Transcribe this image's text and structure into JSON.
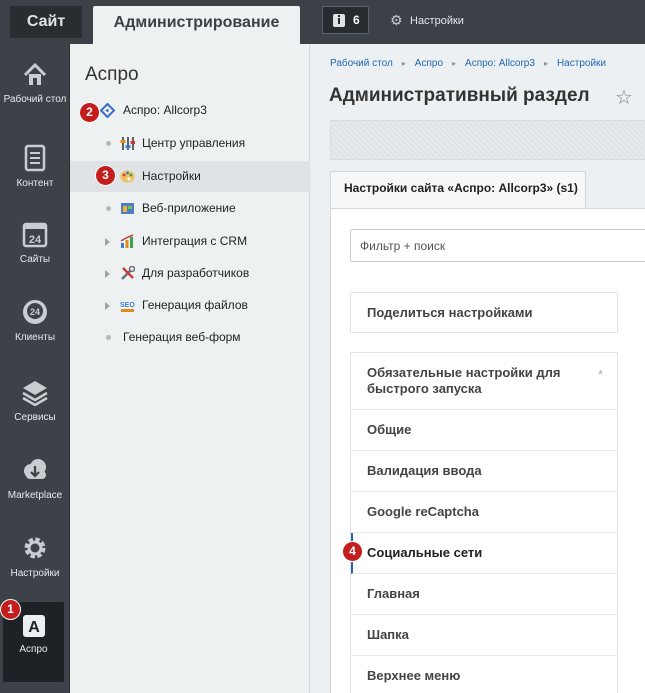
{
  "topbar": {
    "site_tab": "Сайт",
    "admin_tab": "Администрирование",
    "notifications_count": "6",
    "settings_label": "Настройки"
  },
  "rail": {
    "items": [
      {
        "label": "Рабочий стол",
        "icon": "home-icon"
      },
      {
        "label": "Контент",
        "icon": "document-icon"
      },
      {
        "label": "Сайты",
        "icon": "calendar-icon"
      },
      {
        "label": "Клиенты",
        "icon": "clients-icon"
      },
      {
        "label": "Сервисы",
        "icon": "layers-icon"
      },
      {
        "label": "Marketplace",
        "icon": "cloud-download-icon"
      },
      {
        "label": "Настройки",
        "icon": "gear-icon"
      },
      {
        "label": "Аспро",
        "icon": "aspro-a-icon"
      }
    ]
  },
  "sidebar": {
    "title": "Аспро",
    "items": [
      {
        "label": "Аспро: Allcorp3",
        "icon": "aspro-diamond-icon"
      },
      {
        "label": "Центр управления",
        "icon": "sliders-icon"
      },
      {
        "label": "Настройки",
        "icon": "palette-icon"
      },
      {
        "label": "Веб-приложение",
        "icon": "webapp-icon"
      },
      {
        "label": "Интеграция с CRM",
        "icon": "chart-icon"
      },
      {
        "label": "Для разработчиков",
        "icon": "tools-icon"
      },
      {
        "label": "Генерация файлов",
        "icon": "seo-icon"
      },
      {
        "label": "Генерация веб-форм",
        "icon": ""
      }
    ]
  },
  "markers": [
    "1",
    "2",
    "3",
    "4"
  ],
  "main": {
    "breadcrumbs": [
      "Рабочий стол",
      "Аспро",
      "Аспро: Allcorp3",
      "Настройки"
    ],
    "title": "Административный раздел",
    "tab_label": "Настройки сайта «Аспро: Allcorp3» (s1)",
    "filter_placeholder": "Фильтр + поиск",
    "share_label": "Поделиться настройками",
    "settings_items": [
      "Обязательные настройки для быстрого запуска",
      "Общие",
      "Валидация ввода",
      "Google reCaptcha",
      "Социальные сети",
      "Главная",
      "Шапка",
      "Верхнее меню"
    ],
    "required_mark": "*"
  },
  "colors": {
    "topbar": "#3b4147",
    "rail": "#3c4248",
    "marker": "#c41d1d",
    "link": "#2067b0",
    "active_indicator": "#2b65b4"
  }
}
